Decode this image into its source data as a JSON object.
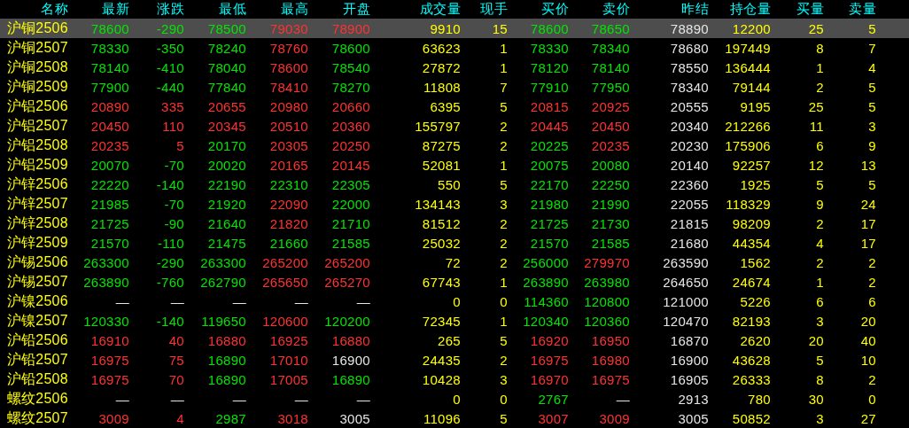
{
  "table": {
    "columns": [
      "名称",
      "最新",
      "涨跌",
      "最低",
      "最高",
      "开盘",
      "成交量",
      "现手",
      "买价",
      "卖价",
      "昨结",
      "持仓量",
      "买量",
      "卖量"
    ],
    "rows": [
      {
        "selected": true,
        "cells": [
          "沪铜2506",
          {
            "text": "78600",
            "color": "#00e600"
          },
          {
            "text": "-290",
            "color": "#00e600"
          },
          {
            "text": "78500",
            "color": "#00e600"
          },
          {
            "text": "79030",
            "color": "#ff3232"
          },
          {
            "text": "78900",
            "color": "#ff3232"
          },
          "9910",
          "15",
          {
            "text": "78600",
            "color": "#00e600"
          },
          {
            "text": "78650",
            "color": "#00e600"
          },
          {
            "text": "78890",
            "color": "#e6e6e6"
          },
          "12200",
          "25",
          "5"
        ]
      },
      {
        "selected": false,
        "cells": [
          "沪铜2507",
          {
            "text": "78330",
            "color": "#00e600"
          },
          {
            "text": "-350",
            "color": "#00e600"
          },
          {
            "text": "78240",
            "color": "#00e600"
          },
          {
            "text": "78760",
            "color": "#ff3232"
          },
          {
            "text": "78600",
            "color": "#00e600"
          },
          "63623",
          "1",
          {
            "text": "78330",
            "color": "#00e600"
          },
          {
            "text": "78340",
            "color": "#00e600"
          },
          {
            "text": "78680",
            "color": "#e6e6e6"
          },
          "197449",
          "8",
          "7"
        ]
      },
      {
        "selected": false,
        "cells": [
          "沪铜2508",
          {
            "text": "78140",
            "color": "#00e600"
          },
          {
            "text": "-410",
            "color": "#00e600"
          },
          {
            "text": "78040",
            "color": "#00e600"
          },
          {
            "text": "78600",
            "color": "#ff3232"
          },
          {
            "text": "78540",
            "color": "#00e600"
          },
          "27872",
          "1",
          {
            "text": "78120",
            "color": "#00e600"
          },
          {
            "text": "78140",
            "color": "#00e600"
          },
          {
            "text": "78550",
            "color": "#e6e6e6"
          },
          "136444",
          "1",
          "4"
        ]
      },
      {
        "selected": false,
        "cells": [
          "沪铜2509",
          {
            "text": "77900",
            "color": "#00e600"
          },
          {
            "text": "-440",
            "color": "#00e600"
          },
          {
            "text": "77840",
            "color": "#00e600"
          },
          {
            "text": "78410",
            "color": "#ff3232"
          },
          {
            "text": "78270",
            "color": "#00e600"
          },
          "11808",
          "7",
          {
            "text": "77910",
            "color": "#00e600"
          },
          {
            "text": "77950",
            "color": "#00e600"
          },
          {
            "text": "78340",
            "color": "#e6e6e6"
          },
          "79144",
          "2",
          "5"
        ]
      },
      {
        "selected": false,
        "cells": [
          "沪铝2506",
          {
            "text": "20890",
            "color": "#ff3232"
          },
          {
            "text": "335",
            "color": "#ff3232"
          },
          {
            "text": "20655",
            "color": "#ff3232"
          },
          {
            "text": "20980",
            "color": "#ff3232"
          },
          {
            "text": "20660",
            "color": "#ff3232"
          },
          "6395",
          "5",
          {
            "text": "20815",
            "color": "#ff3232"
          },
          {
            "text": "20925",
            "color": "#ff3232"
          },
          {
            "text": "20555",
            "color": "#e6e6e6"
          },
          "9195",
          "25",
          "5"
        ]
      },
      {
        "selected": false,
        "cells": [
          "沪铝2507",
          {
            "text": "20450",
            "color": "#ff3232"
          },
          {
            "text": "110",
            "color": "#ff3232"
          },
          {
            "text": "20345",
            "color": "#ff3232"
          },
          {
            "text": "20510",
            "color": "#ff3232"
          },
          {
            "text": "20360",
            "color": "#ff3232"
          },
          "155797",
          "2",
          {
            "text": "20445",
            "color": "#ff3232"
          },
          {
            "text": "20450",
            "color": "#ff3232"
          },
          {
            "text": "20340",
            "color": "#e6e6e6"
          },
          "212266",
          "11",
          "3"
        ]
      },
      {
        "selected": false,
        "cells": [
          "沪铝2508",
          {
            "text": "20235",
            "color": "#ff3232"
          },
          {
            "text": "5",
            "color": "#ff3232"
          },
          {
            "text": "20170",
            "color": "#00e600"
          },
          {
            "text": "20305",
            "color": "#ff3232"
          },
          {
            "text": "20250",
            "color": "#ff3232"
          },
          "87275",
          "2",
          {
            "text": "20225",
            "color": "#00e600"
          },
          {
            "text": "20235",
            "color": "#ff3232"
          },
          {
            "text": "20230",
            "color": "#e6e6e6"
          },
          "175906",
          "6",
          "9"
        ]
      },
      {
        "selected": false,
        "cells": [
          "沪铝2509",
          {
            "text": "20070",
            "color": "#00e600"
          },
          {
            "text": "-70",
            "color": "#00e600"
          },
          {
            "text": "20020",
            "color": "#00e600"
          },
          {
            "text": "20165",
            "color": "#ff3232"
          },
          {
            "text": "20145",
            "color": "#ff3232"
          },
          "52081",
          "1",
          {
            "text": "20075",
            "color": "#00e600"
          },
          {
            "text": "20080",
            "color": "#00e600"
          },
          {
            "text": "20140",
            "color": "#e6e6e6"
          },
          "92257",
          "12",
          "13"
        ]
      },
      {
        "selected": false,
        "cells": [
          "沪锌2506",
          {
            "text": "22220",
            "color": "#00e600"
          },
          {
            "text": "-140",
            "color": "#00e600"
          },
          {
            "text": "22190",
            "color": "#00e600"
          },
          {
            "text": "22310",
            "color": "#00e600"
          },
          {
            "text": "22305",
            "color": "#00e600"
          },
          "550",
          "5",
          {
            "text": "22170",
            "color": "#00e600"
          },
          {
            "text": "22250",
            "color": "#00e600"
          },
          {
            "text": "22360",
            "color": "#e6e6e6"
          },
          "1925",
          "5",
          "5"
        ]
      },
      {
        "selected": false,
        "cells": [
          "沪锌2507",
          {
            "text": "21985",
            "color": "#00e600"
          },
          {
            "text": "-70",
            "color": "#00e600"
          },
          {
            "text": "21920",
            "color": "#00e600"
          },
          {
            "text": "22090",
            "color": "#ff3232"
          },
          {
            "text": "22000",
            "color": "#00e600"
          },
          "134143",
          "3",
          {
            "text": "21980",
            "color": "#00e600"
          },
          {
            "text": "21990",
            "color": "#00e600"
          },
          {
            "text": "22055",
            "color": "#e6e6e6"
          },
          "118329",
          "9",
          "24"
        ]
      },
      {
        "selected": false,
        "cells": [
          "沪锌2508",
          {
            "text": "21725",
            "color": "#00e600"
          },
          {
            "text": "-90",
            "color": "#00e600"
          },
          {
            "text": "21640",
            "color": "#00e600"
          },
          {
            "text": "21820",
            "color": "#ff3232"
          },
          {
            "text": "21710",
            "color": "#00e600"
          },
          "81512",
          "2",
          {
            "text": "21725",
            "color": "#00e600"
          },
          {
            "text": "21730",
            "color": "#00e600"
          },
          {
            "text": "21815",
            "color": "#e6e6e6"
          },
          "98209",
          "2",
          "17"
        ]
      },
      {
        "selected": false,
        "cells": [
          "沪锌2509",
          {
            "text": "21570",
            "color": "#00e600"
          },
          {
            "text": "-110",
            "color": "#00e600"
          },
          {
            "text": "21475",
            "color": "#00e600"
          },
          {
            "text": "21660",
            "color": "#00e600"
          },
          {
            "text": "21585",
            "color": "#00e600"
          },
          "25032",
          "2",
          {
            "text": "21570",
            "color": "#00e600"
          },
          {
            "text": "21585",
            "color": "#00e600"
          },
          {
            "text": "21680",
            "color": "#e6e6e6"
          },
          "44354",
          "4",
          "17"
        ]
      },
      {
        "selected": false,
        "cells": [
          "沪锡2506",
          {
            "text": "263300",
            "color": "#00e600"
          },
          {
            "text": "-290",
            "color": "#00e600"
          },
          {
            "text": "263300",
            "color": "#00e600"
          },
          {
            "text": "265200",
            "color": "#ff3232"
          },
          {
            "text": "265200",
            "color": "#ff3232"
          },
          "72",
          "2",
          {
            "text": "256000",
            "color": "#00e600"
          },
          {
            "text": "279970",
            "color": "#ff3232"
          },
          {
            "text": "263590",
            "color": "#e6e6e6"
          },
          "1562",
          "2",
          "2"
        ]
      },
      {
        "selected": false,
        "cells": [
          "沪锡2507",
          {
            "text": "263890",
            "color": "#00e600"
          },
          {
            "text": "-760",
            "color": "#00e600"
          },
          {
            "text": "262790",
            "color": "#00e600"
          },
          {
            "text": "265650",
            "color": "#ff3232"
          },
          {
            "text": "265270",
            "color": "#ff3232"
          },
          "67743",
          "1",
          {
            "text": "263890",
            "color": "#00e600"
          },
          {
            "text": "263980",
            "color": "#00e600"
          },
          {
            "text": "264650",
            "color": "#e6e6e6"
          },
          "24674",
          "1",
          "2"
        ]
      },
      {
        "selected": false,
        "cells": [
          "沪镍2506",
          {
            "text": "—",
            "color": "#e6e6e6"
          },
          {
            "text": "—",
            "color": "#e6e6e6"
          },
          {
            "text": "—",
            "color": "#e6e6e6"
          },
          {
            "text": "—",
            "color": "#e6e6e6"
          },
          {
            "text": "—",
            "color": "#e6e6e6"
          },
          "0",
          "0",
          {
            "text": "114360",
            "color": "#00e600"
          },
          {
            "text": "120800",
            "color": "#00e600"
          },
          {
            "text": "121000",
            "color": "#e6e6e6"
          },
          "5226",
          "6",
          "6"
        ]
      },
      {
        "selected": false,
        "cells": [
          "沪镍2507",
          {
            "text": "120330",
            "color": "#00e600"
          },
          {
            "text": "-140",
            "color": "#00e600"
          },
          {
            "text": "119650",
            "color": "#00e600"
          },
          {
            "text": "120600",
            "color": "#ff3232"
          },
          {
            "text": "120200",
            "color": "#00e600"
          },
          "72345",
          "1",
          {
            "text": "120340",
            "color": "#00e600"
          },
          {
            "text": "120360",
            "color": "#00e600"
          },
          {
            "text": "120470",
            "color": "#e6e6e6"
          },
          "82193",
          "3",
          "20"
        ]
      },
      {
        "selected": false,
        "cells": [
          "沪铅2506",
          {
            "text": "16910",
            "color": "#ff3232"
          },
          {
            "text": "40",
            "color": "#ff3232"
          },
          {
            "text": "16880",
            "color": "#ff3232"
          },
          {
            "text": "16925",
            "color": "#ff3232"
          },
          {
            "text": "16880",
            "color": "#ff3232"
          },
          "265",
          "5",
          {
            "text": "16920",
            "color": "#ff3232"
          },
          {
            "text": "16950",
            "color": "#ff3232"
          },
          {
            "text": "16870",
            "color": "#e6e6e6"
          },
          "2620",
          "20",
          "40"
        ]
      },
      {
        "selected": false,
        "cells": [
          "沪铅2507",
          {
            "text": "16975",
            "color": "#ff3232"
          },
          {
            "text": "75",
            "color": "#ff3232"
          },
          {
            "text": "16890",
            "color": "#00e600"
          },
          {
            "text": "17010",
            "color": "#ff3232"
          },
          {
            "text": "16900",
            "color": "#e6e6e6"
          },
          "24435",
          "2",
          {
            "text": "16975",
            "color": "#ff3232"
          },
          {
            "text": "16980",
            "color": "#ff3232"
          },
          {
            "text": "16900",
            "color": "#e6e6e6"
          },
          "43628",
          "5",
          "10"
        ]
      },
      {
        "selected": false,
        "cells": [
          "沪铅2508",
          {
            "text": "16975",
            "color": "#ff3232"
          },
          {
            "text": "70",
            "color": "#ff3232"
          },
          {
            "text": "16890",
            "color": "#00e600"
          },
          {
            "text": "17005",
            "color": "#ff3232"
          },
          {
            "text": "16890",
            "color": "#00e600"
          },
          "10428",
          "3",
          {
            "text": "16970",
            "color": "#ff3232"
          },
          {
            "text": "16975",
            "color": "#ff3232"
          },
          {
            "text": "16905",
            "color": "#e6e6e6"
          },
          "26333",
          "8",
          "2"
        ]
      },
      {
        "selected": false,
        "cells": [
          "螺纹2506",
          {
            "text": "—",
            "color": "#e6e6e6"
          },
          {
            "text": "—",
            "color": "#e6e6e6"
          },
          {
            "text": "—",
            "color": "#e6e6e6"
          },
          {
            "text": "—",
            "color": "#e6e6e6"
          },
          {
            "text": "—",
            "color": "#e6e6e6"
          },
          "0",
          "0",
          {
            "text": "2767",
            "color": "#00e600"
          },
          {
            "text": "—",
            "color": "#e6e6e6"
          },
          {
            "text": "2913",
            "color": "#e6e6e6"
          },
          "780",
          "30",
          "0"
        ]
      },
      {
        "selected": false,
        "cells": [
          "螺纹2507",
          {
            "text": "3009",
            "color": "#ff3232"
          },
          {
            "text": "4",
            "color": "#ff3232"
          },
          {
            "text": "2987",
            "color": "#00e600"
          },
          {
            "text": "3018",
            "color": "#ff3232"
          },
          {
            "text": "3005",
            "color": "#e6e6e6"
          },
          "11096",
          "5",
          {
            "text": "3007",
            "color": "#ff3232"
          },
          {
            "text": "3009",
            "color": "#ff3232"
          },
          {
            "text": "3005",
            "color": "#e6e6e6"
          },
          "50852",
          "3",
          "27"
        ]
      }
    ]
  }
}
